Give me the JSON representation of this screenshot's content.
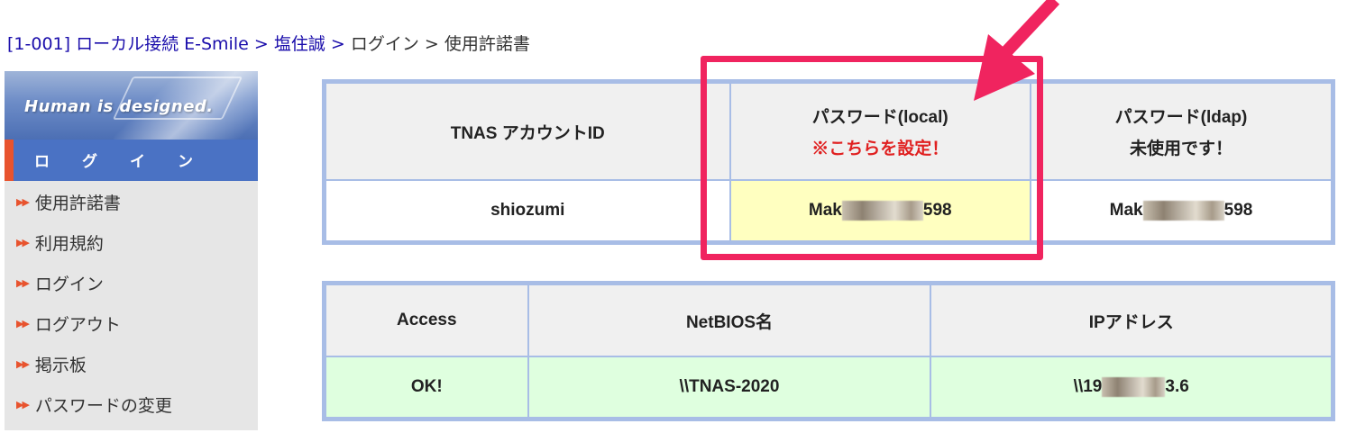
{
  "breadcrumb": {
    "link1": "[1-001] ローカル接続 E-Smile",
    "link2": "塩住誠",
    "item3": "ログイン",
    "current": "使用許諾書",
    "sep": ">"
  },
  "sidebar": {
    "banner_text": "Human is designed.",
    "section_label": "ログイン",
    "items": [
      {
        "label": "使用許諾書"
      },
      {
        "label": "利用規約"
      },
      {
        "label": "ログイン"
      },
      {
        "label": "ログアウト"
      },
      {
        "label": "掲示板"
      },
      {
        "label": "パスワードの変更"
      }
    ],
    "bullet": "▶▶"
  },
  "account_table": {
    "headers": {
      "account_id": "TNAS アカウントID",
      "local_line1": "パスワード(local)",
      "local_line2": "※こちらを設定！",
      "ldap_line1": "パスワード(ldap)",
      "ldap_line2": "未使用です！"
    },
    "row": {
      "account_id": "shiozumi",
      "local_prefix": "Mak",
      "local_suffix": "598",
      "ldap_prefix": "Mak",
      "ldap_suffix": "598"
    }
  },
  "access_table": {
    "headers": {
      "access": "Access",
      "netbios": "NetBIOS名",
      "ip": "IPアドレス"
    },
    "row": {
      "access": "OK!",
      "netbios": "\\\\TNAS-2020",
      "ip_prefix": "\\\\19",
      "ip_suffix": "3.6"
    }
  },
  "colors": {
    "link": "#1a0dab",
    "accent_red": "#e02020",
    "annotation": "#f0245f",
    "table_border": "#a8bde6",
    "sidebar_section": "#4a72c4"
  }
}
